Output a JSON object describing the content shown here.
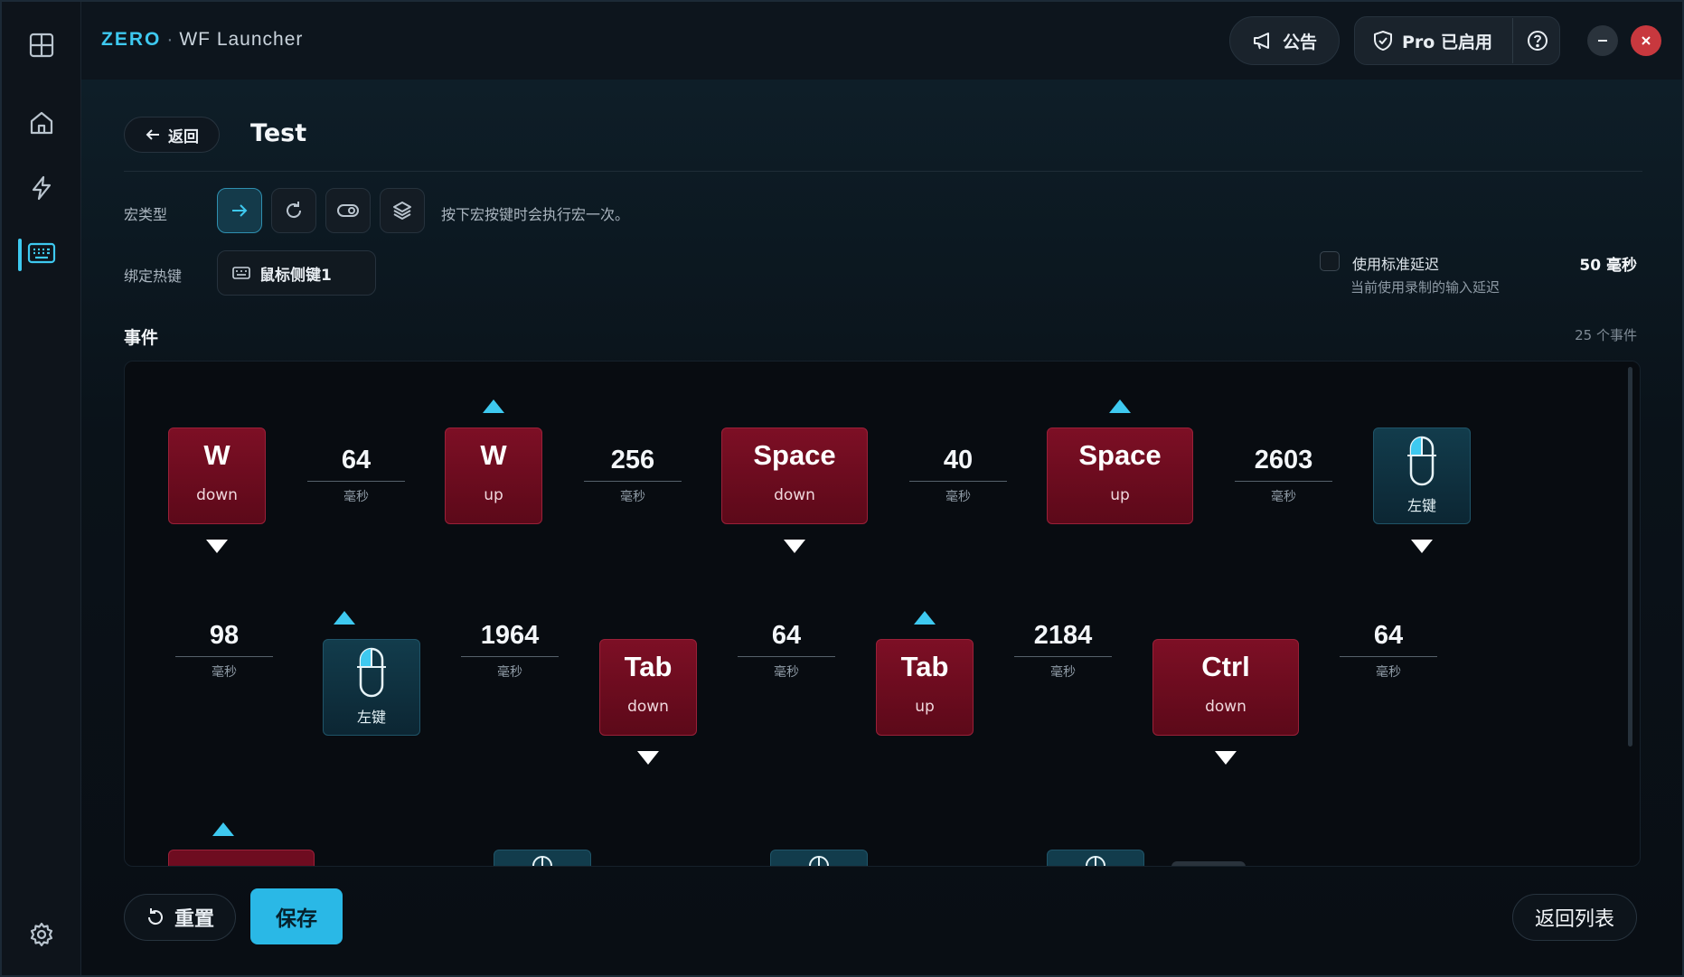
{
  "brand": {
    "zero": "ZERO",
    "separator": "·",
    "name": "WF Launcher"
  },
  "header": {
    "announcement_label": "公告",
    "pro_label": "Pro 已启用"
  },
  "page": {
    "back_label": "返回",
    "title": "Test"
  },
  "macro_type": {
    "label": "宏类型",
    "description": "按下宏按键时会执行宏一次。",
    "options": [
      "single-run-icon",
      "repeat-icon",
      "toggle-icon",
      "layers-icon"
    ],
    "selected": 0
  },
  "hotkey": {
    "label": "绑定热键",
    "value": "鼠标侧键1"
  },
  "delay_setting": {
    "title": "使用标准延迟",
    "subtitle": "当前使用录制的输入延迟",
    "value": "50 毫秒",
    "checked": false
  },
  "events": {
    "title": "事件",
    "count": "25 个事件",
    "row1": {
      "k1": {
        "name": "W",
        "state": "down"
      },
      "d1": {
        "value": "64",
        "unit": "毫秒"
      },
      "k2": {
        "name": "W",
        "state": "up"
      },
      "d2": {
        "value": "256",
        "unit": "毫秒"
      },
      "k3": {
        "name": "Space",
        "state": "down"
      },
      "d3": {
        "value": "40",
        "unit": "毫秒"
      },
      "k4": {
        "name": "Space",
        "state": "up"
      },
      "d4": {
        "value": "2603",
        "unit": "毫秒"
      },
      "m1": {
        "name": "左键"
      }
    },
    "row2": {
      "d1": {
        "value": "98",
        "unit": "毫秒"
      },
      "m1": {
        "name": "左键"
      },
      "d2": {
        "value": "1964",
        "unit": "毫秒"
      },
      "k1": {
        "name": "Tab",
        "state": "down"
      },
      "d3": {
        "value": "64",
        "unit": "毫秒"
      },
      "k2": {
        "name": "Tab",
        "state": "up"
      },
      "d4": {
        "value": "2184",
        "unit": "毫秒"
      },
      "k3": {
        "name": "Ctrl",
        "state": "down"
      },
      "d5": {
        "value": "64",
        "unit": "毫秒"
      }
    }
  },
  "footer": {
    "reset_label": "重置",
    "save_label": "保存",
    "back_to_list_label": "返回列表"
  },
  "colors": {
    "accent": "#3ec9f0",
    "key_bg": "#6e0c20",
    "mouse_bg": "#123c4c",
    "save_bg": "#2ab8e6"
  }
}
